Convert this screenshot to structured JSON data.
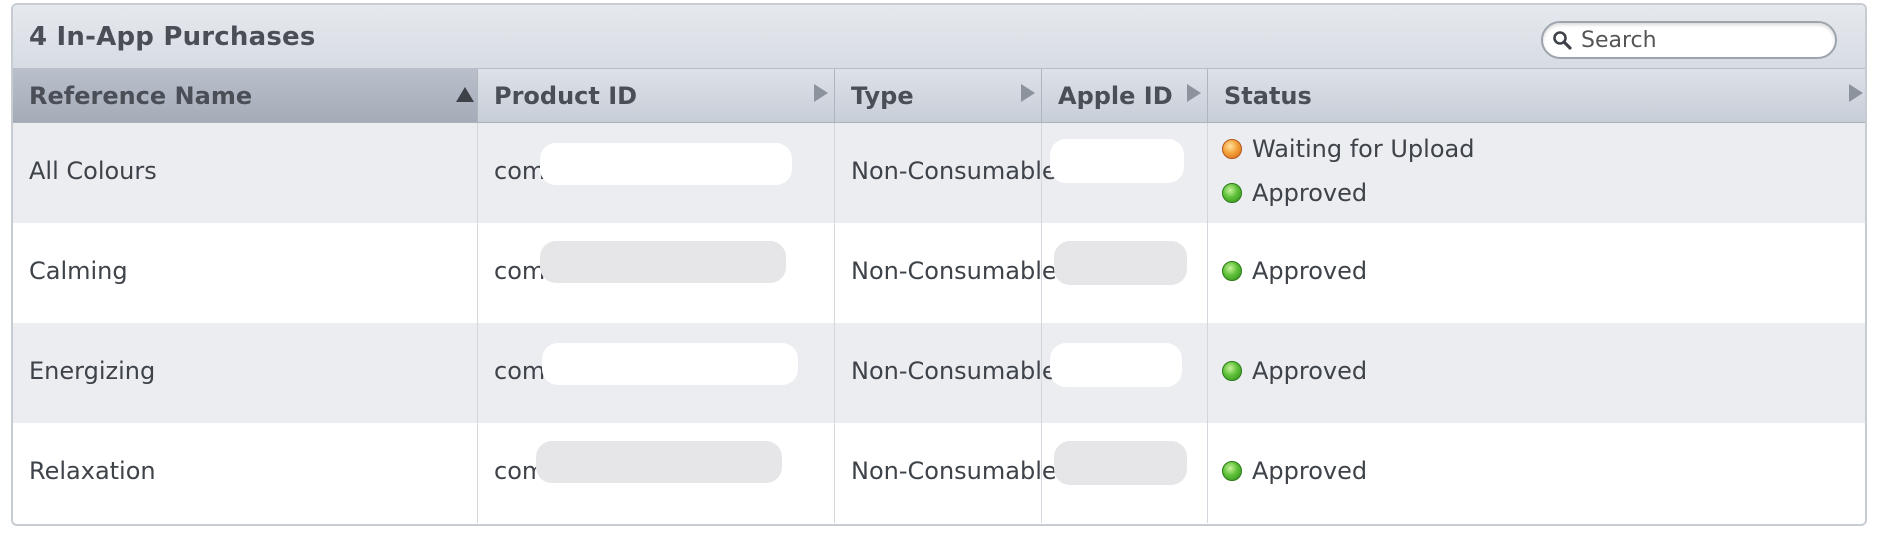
{
  "panel": {
    "title": "4 In-App Purchases",
    "search": {
      "placeholder": "Search",
      "value": ""
    }
  },
  "columns": [
    {
      "label": "Reference Name",
      "sort": "ascending"
    },
    {
      "label": "Product ID",
      "sort": "none"
    },
    {
      "label": "Type",
      "sort": "none"
    },
    {
      "label": "Apple ID",
      "sort": "none"
    },
    {
      "label": "Status",
      "sort": "none"
    }
  ],
  "rows": [
    {
      "reference_name": "All Colours",
      "product_id": "com.",
      "type": "Non-Consumable",
      "statuses": [
        {
          "text": "Waiting for Upload",
          "color": "orange"
        },
        {
          "text": "Approved",
          "color": "green"
        }
      ]
    },
    {
      "reference_name": "Calming",
      "product_id": "com.",
      "type": "Non-Consumable",
      "statuses": [
        {
          "text": "Approved",
          "color": "green"
        }
      ]
    },
    {
      "reference_name": "Energizing",
      "product_id": "com.s",
      "type": "Non-Consumable",
      "statuses": [
        {
          "text": "Approved",
          "color": "green"
        }
      ]
    },
    {
      "reference_name": "Relaxation",
      "product_id": "com.",
      "type": "Non-Consumable",
      "statuses": [
        {
          "text": "Approved",
          "color": "green"
        }
      ]
    }
  ],
  "icons": {
    "search": "search-icon",
    "sort_ascending": "sort-ascending-icon",
    "sort": "sort-arrow-icon"
  },
  "colors": {
    "status_approved": "#5fc13a",
    "status_waiting": "#f3a23a",
    "header_sorted": "#a4acb8"
  }
}
